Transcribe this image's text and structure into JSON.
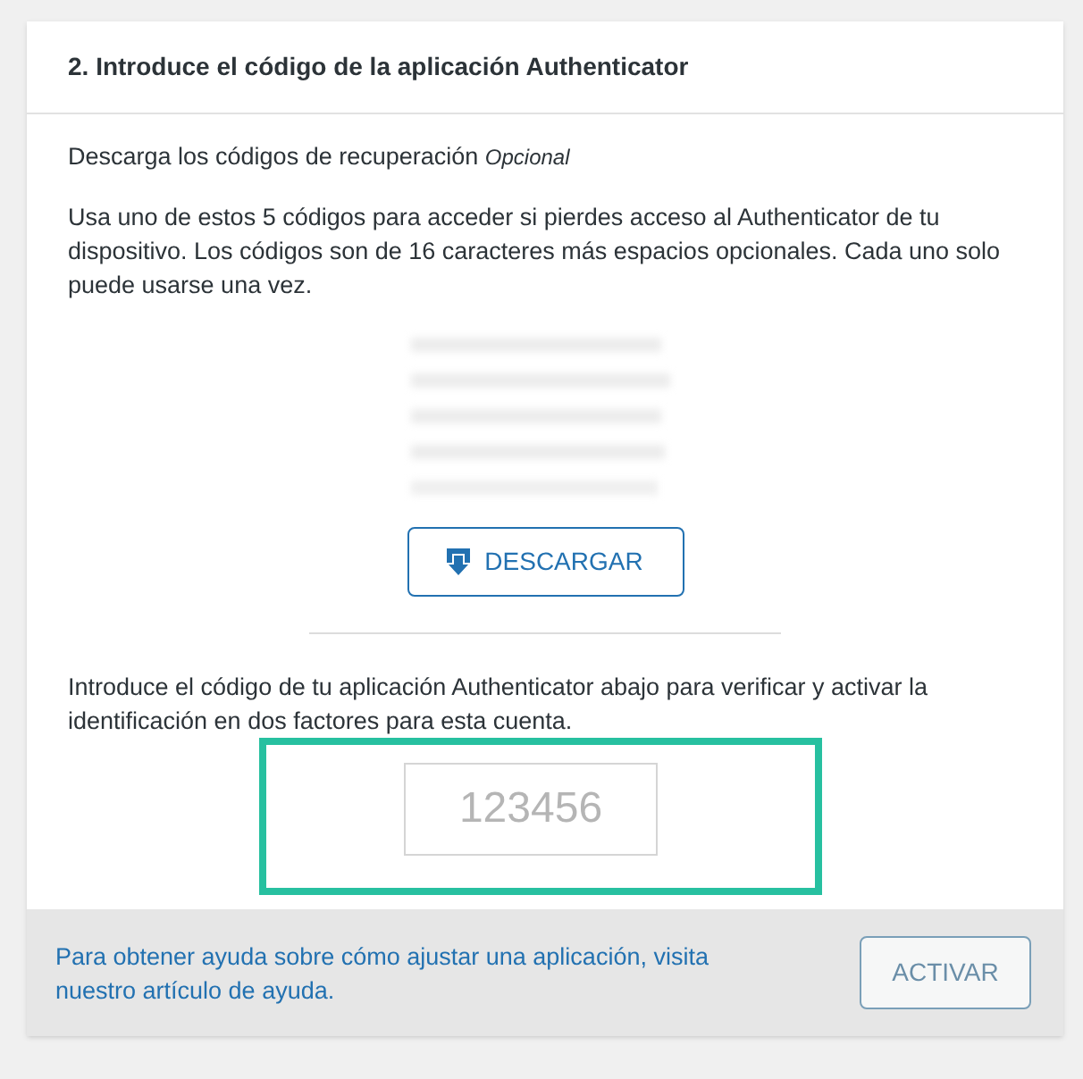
{
  "card": {
    "title": "2. Introduce el código de la aplicación Authenticator"
  },
  "recovery": {
    "heading": "Descarga los códigos de recuperación",
    "optional_tag": "Opcional",
    "description": "Usa uno de estos 5 códigos para acceder si pierdes acceso al Authenticator de tu dispositivo. Los códigos son de 16 caracteres más espacios opcionales. Cada uno solo puede usarse una vez.",
    "download_button": "DESCARGAR"
  },
  "verify": {
    "instructions": "Introduce el código de tu aplicación Authenticator abajo para verificar y activar la identificación en dos factores para esta cuenta.",
    "code_field": {
      "placeholder": "123456"
    },
    "highlighted": true
  },
  "footer": {
    "help_text": "Para obtener ayuda sobre cómo ajustar una aplicación, visita nuestro artículo de ayuda.",
    "activate_button": {
      "label": "ACTIVAR",
      "disabled": true
    }
  }
}
